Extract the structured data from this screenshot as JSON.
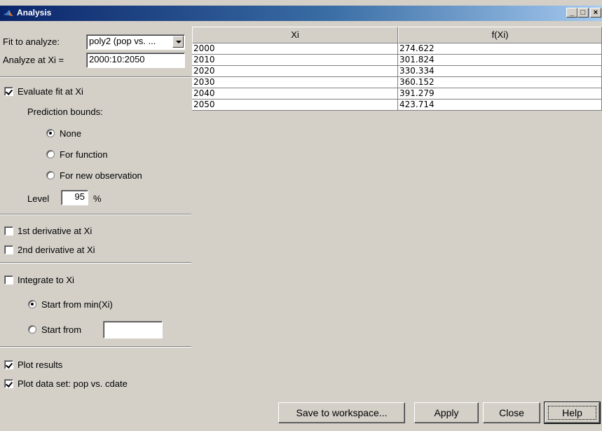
{
  "window": {
    "title": "Analysis",
    "buttons": {
      "minimize": "_",
      "maximize": "□",
      "close": "×"
    }
  },
  "left": {
    "fit_label": "Fit to analyze:",
    "fit_value": "poly2 (pop vs. ...",
    "analyze_label": "Analyze at Xi =",
    "analyze_value": "2000:10:2050",
    "evaluate_label": "Evaluate fit at Xi",
    "evaluate_checked": true,
    "prediction_label": "Prediction bounds:",
    "bounds": [
      "None",
      "For function",
      "For new observation"
    ],
    "level_label": "Level",
    "level_value": "95",
    "level_unit": "%",
    "deriv1_label": "1st derivative at Xi",
    "deriv2_label": "2nd derivative at Xi",
    "integrate_label": "Integrate to Xi",
    "start_min_label": "Start from min(Xi)",
    "start_from_label": "Start from",
    "start_from_value": "",
    "plot_results_label": "Plot results",
    "plot_data_label": "Plot data set: pop vs. cdate"
  },
  "table": {
    "headers": [
      "Xi",
      "f(Xi)"
    ],
    "rows": [
      [
        "2000",
        "274.622"
      ],
      [
        "2010",
        "301.824"
      ],
      [
        "2020",
        "330.334"
      ],
      [
        "2030",
        "360.152"
      ],
      [
        "2040",
        "391.279"
      ],
      [
        "2050",
        "423.714"
      ]
    ]
  },
  "buttons": {
    "save": "Save to workspace...",
    "apply": "Apply",
    "close": "Close",
    "help": "Help"
  },
  "colors": {
    "face": "#d4d0c8",
    "title_start": "#0a246a",
    "title_end": "#a6caf0"
  },
  "icons": {
    "app": "matlab-logo-icon",
    "combo": "chevron-down-icon"
  }
}
